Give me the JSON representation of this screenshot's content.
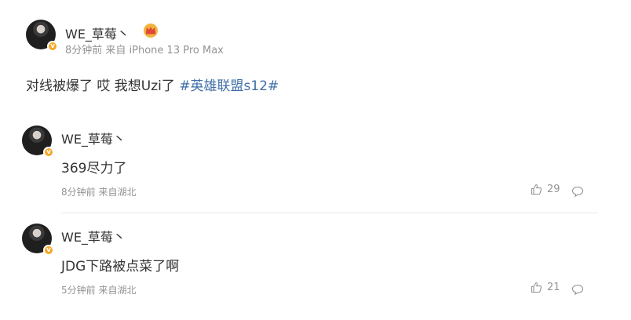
{
  "post": {
    "author": "WE_草莓丶",
    "meta": "8分钟前 来自 iPhone 13 Pro Max",
    "text": "对线被爆了 哎 我想Uzi了 ",
    "hashtag": "#英雄联盟s12#"
  },
  "comments": [
    {
      "author": "WE_草莓丶",
      "text": "369尽力了",
      "meta": "8分钟前 来自湖北",
      "likes": "29"
    },
    {
      "author": "WE_草莓丶",
      "text": "JDG下路被点菜了啊",
      "meta": "5分钟前 来自湖北",
      "likes": "21"
    }
  ],
  "colors": {
    "hashtag": "#3f6ea7",
    "meta": "#939393",
    "badge": "#f5a623"
  },
  "icons": [
    "verified-badge-icon",
    "crown-badge-icon",
    "thumbs-up-icon",
    "comment-icon"
  ]
}
